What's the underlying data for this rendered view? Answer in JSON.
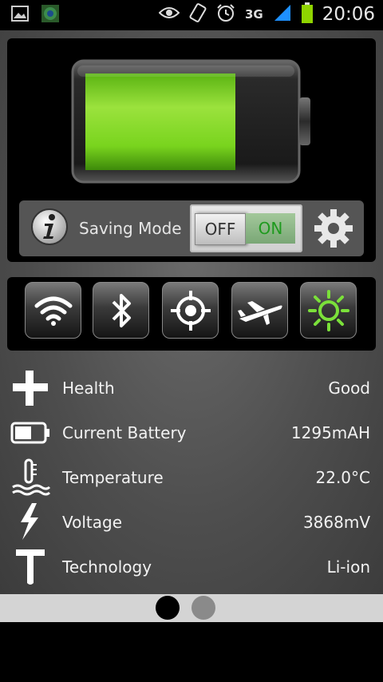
{
  "status_bar": {
    "network": "3G",
    "time": "20:06",
    "icons": [
      "gallery-icon",
      "app-icon",
      "eye-icon",
      "rotate-icon",
      "alarm-icon",
      "signal-icon",
      "battery-icon"
    ]
  },
  "battery_panel": {
    "charge_fraction": 0.73,
    "fill_color": "#79d41e",
    "saving_mode_label": "Saving Mode",
    "toggle": {
      "off_label": "OFF",
      "on_label": "ON",
      "state": "on"
    }
  },
  "quick_toggles": [
    {
      "name": "wifi",
      "icon": "wifi-icon",
      "active": false
    },
    {
      "name": "bluetooth",
      "icon": "bluetooth-icon",
      "active": false
    },
    {
      "name": "gps",
      "icon": "gps-icon",
      "active": false
    },
    {
      "name": "airplane",
      "icon": "airplane-icon",
      "active": false
    },
    {
      "name": "brightness",
      "icon": "brightness-icon",
      "active": true,
      "active_color": "#7be03a"
    }
  ],
  "info": [
    {
      "icon": "health-icon",
      "label": "Health",
      "value": "Good"
    },
    {
      "icon": "battery-icon",
      "label": "Current Battery",
      "value": "1295mAH"
    },
    {
      "icon": "temperature-icon",
      "label": "Temperature",
      "value": "22.0°C"
    },
    {
      "icon": "voltage-icon",
      "label": "Voltage",
      "value": "3868mV"
    },
    {
      "icon": "technology-icon",
      "label": "Technology",
      "value": "Li-ion"
    }
  ],
  "pager": {
    "current_page": 1,
    "page_count": 2
  }
}
